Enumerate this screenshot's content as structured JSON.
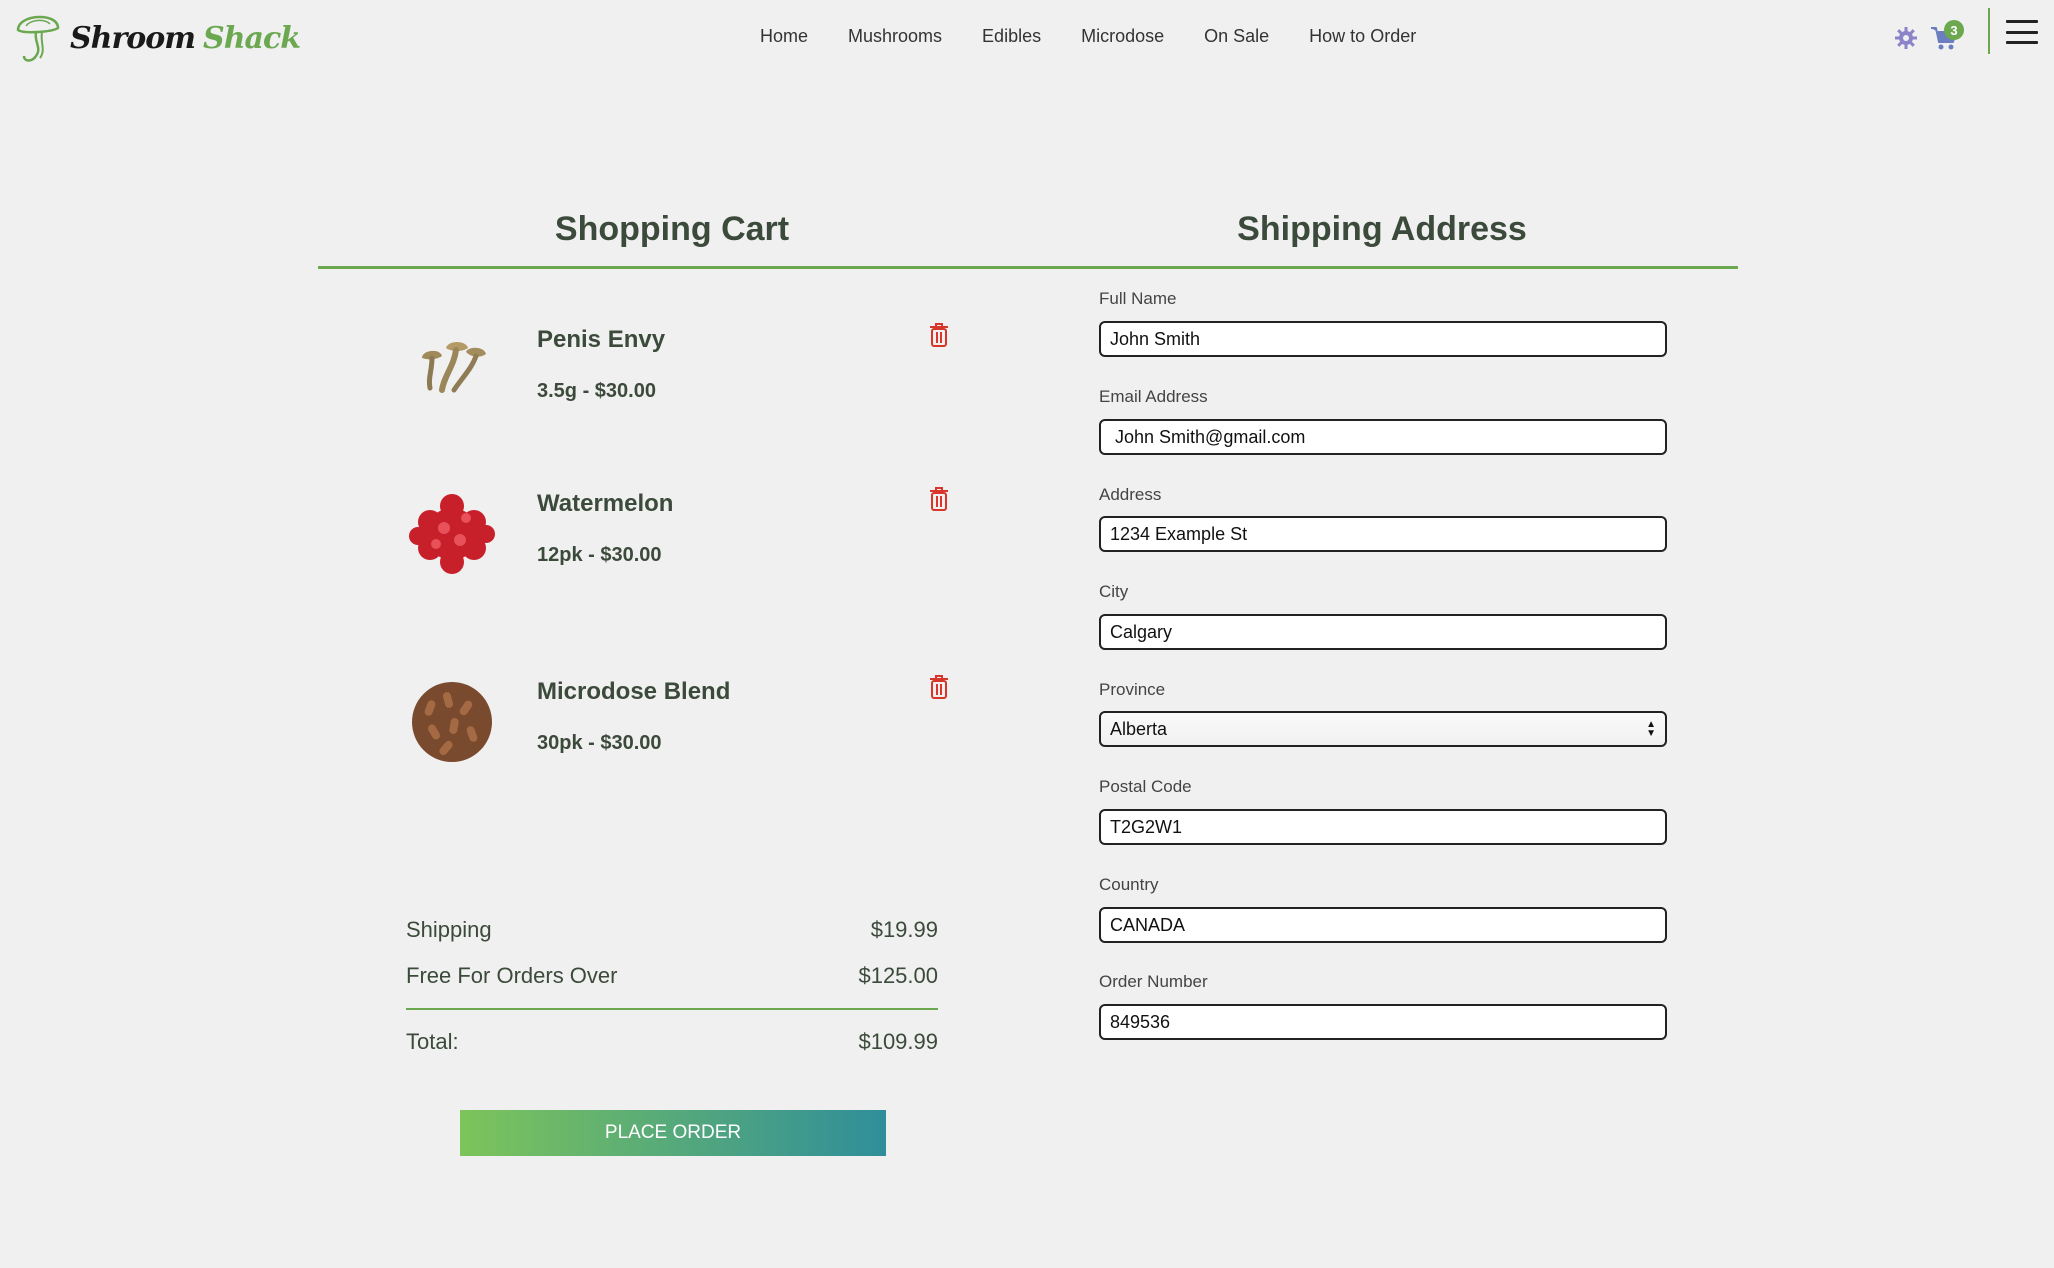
{
  "brand": {
    "word1": "Shroom",
    "word2": "Shack"
  },
  "nav": [
    "Home",
    "Mushrooms",
    "Edibles",
    "Microdose",
    "On Sale",
    "How to Order"
  ],
  "header": {
    "cart_count": "3"
  },
  "cart": {
    "title": "Shopping Cart",
    "items": [
      {
        "name": "Penis Envy",
        "detail": "3.5g - $30.00"
      },
      {
        "name": "Watermelon",
        "detail": "12pk - $30.00"
      },
      {
        "name": "Microdose Blend",
        "detail": "30pk - $30.00"
      }
    ],
    "shipping_label": "Shipping",
    "shipping_value": "$19.99",
    "free_label": "Free For Orders Over",
    "free_value": "$125.00",
    "total_label": "Total:",
    "total_value": "$109.99",
    "place_order": "PLACE ORDER"
  },
  "shipping": {
    "title": "Shipping Address",
    "fields": [
      {
        "label": "Full Name",
        "value": "John Smith"
      },
      {
        "label": "Email Address",
        "value": " John Smith@gmail.com"
      },
      {
        "label": "Address",
        "value": "1234 Example St"
      },
      {
        "label": "City",
        "value": "Calgary"
      },
      {
        "label": "Province",
        "value": "Alberta"
      },
      {
        "label": "Postal Code",
        "value": "T2G2W1"
      },
      {
        "label": "Country",
        "value": "CANADA"
      },
      {
        "label": "Order Number",
        "value": "849536"
      }
    ]
  },
  "colors": {
    "accent": "#6ba84f",
    "trash": "#d9362b",
    "heading": "#3b4a3a",
    "btn_start": "#7dc45b",
    "btn_end": "#2f8e9a"
  },
  "icons": {
    "gear": "gear-icon",
    "cart": "cart-icon",
    "menu": "hamburger-icon",
    "trash": "trash-icon",
    "logo": "mushroom-logo-icon"
  }
}
